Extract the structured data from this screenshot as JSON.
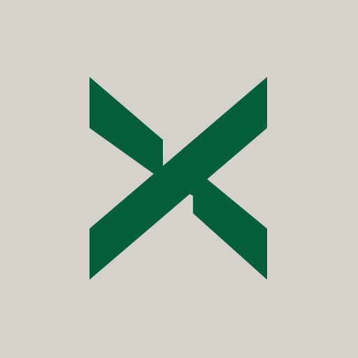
{
  "icon": {
    "name": "x-mark-logo-icon",
    "background_color": "#D5D1CB",
    "mark_color": "#075E3A"
  }
}
